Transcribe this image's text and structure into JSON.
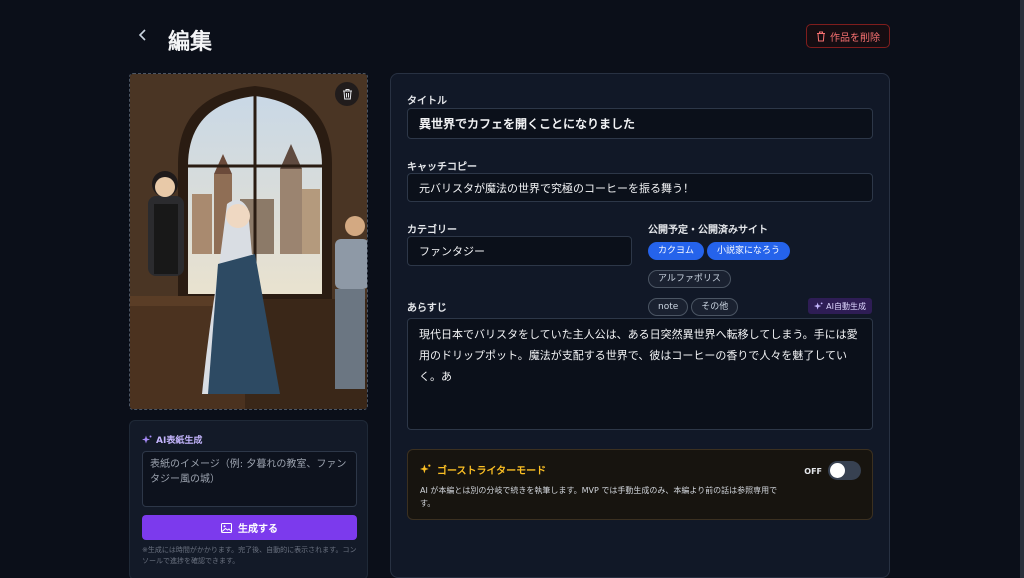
{
  "header": {
    "title": "編集",
    "back_icon": "chevron-left-icon",
    "delete_work_label": "作品を削除"
  },
  "cover": {
    "ai_panel_title": "AI表紙生成",
    "prompt_placeholder": "表紙のイメージ（例: 夕暮れの教室、ファンタジー風の城）",
    "generate_label": "生成する",
    "note": "※生成には時間がかかります。完了後、自動的に表示されます。コンソールで進捗を確認できます。"
  },
  "form": {
    "title_label": "タイトル",
    "title_value": "異世界でカフェを開くことになりました",
    "catch_label": "キャッチコピー",
    "catch_value": "元バリスタが魔法の世界で究極のコーヒーを振る舞う！",
    "category_label": "カテゴリー",
    "category_value": "ファンタジー",
    "sites_label": "公開予定・公開済みサイト",
    "sites": [
      {
        "label": "カクヨム",
        "active": true
      },
      {
        "label": "小説家になろう",
        "active": true
      },
      {
        "label": "アルファポリス",
        "active": false
      },
      {
        "label": "note",
        "active": false
      },
      {
        "label": "その他",
        "active": false
      }
    ],
    "synopsis_label": "あらすじ",
    "ai_summary_label": "AI自動生成",
    "synopsis_value": "現代日本でバリスタをしていた主人公は、ある日突然異世界へ転移してしまう。手には愛用のドリップポット。魔法が支配する世界で、彼はコーヒーの香りで人々を魅了していく。あ"
  },
  "ghost": {
    "title": "ゴーストライターモード",
    "description": "AI が本編とは別の分岐で続きを執筆します。MVP では手動生成のみ、本編より前の話は参照専用です。",
    "toggle_label": "OFF",
    "enabled": false
  },
  "colors": {
    "background": "#0b0f19",
    "accent_purple": "#7c3aed",
    "accent_blue": "#2563eb",
    "danger": "#f87171",
    "ghost_gold": "#fbbf24"
  }
}
